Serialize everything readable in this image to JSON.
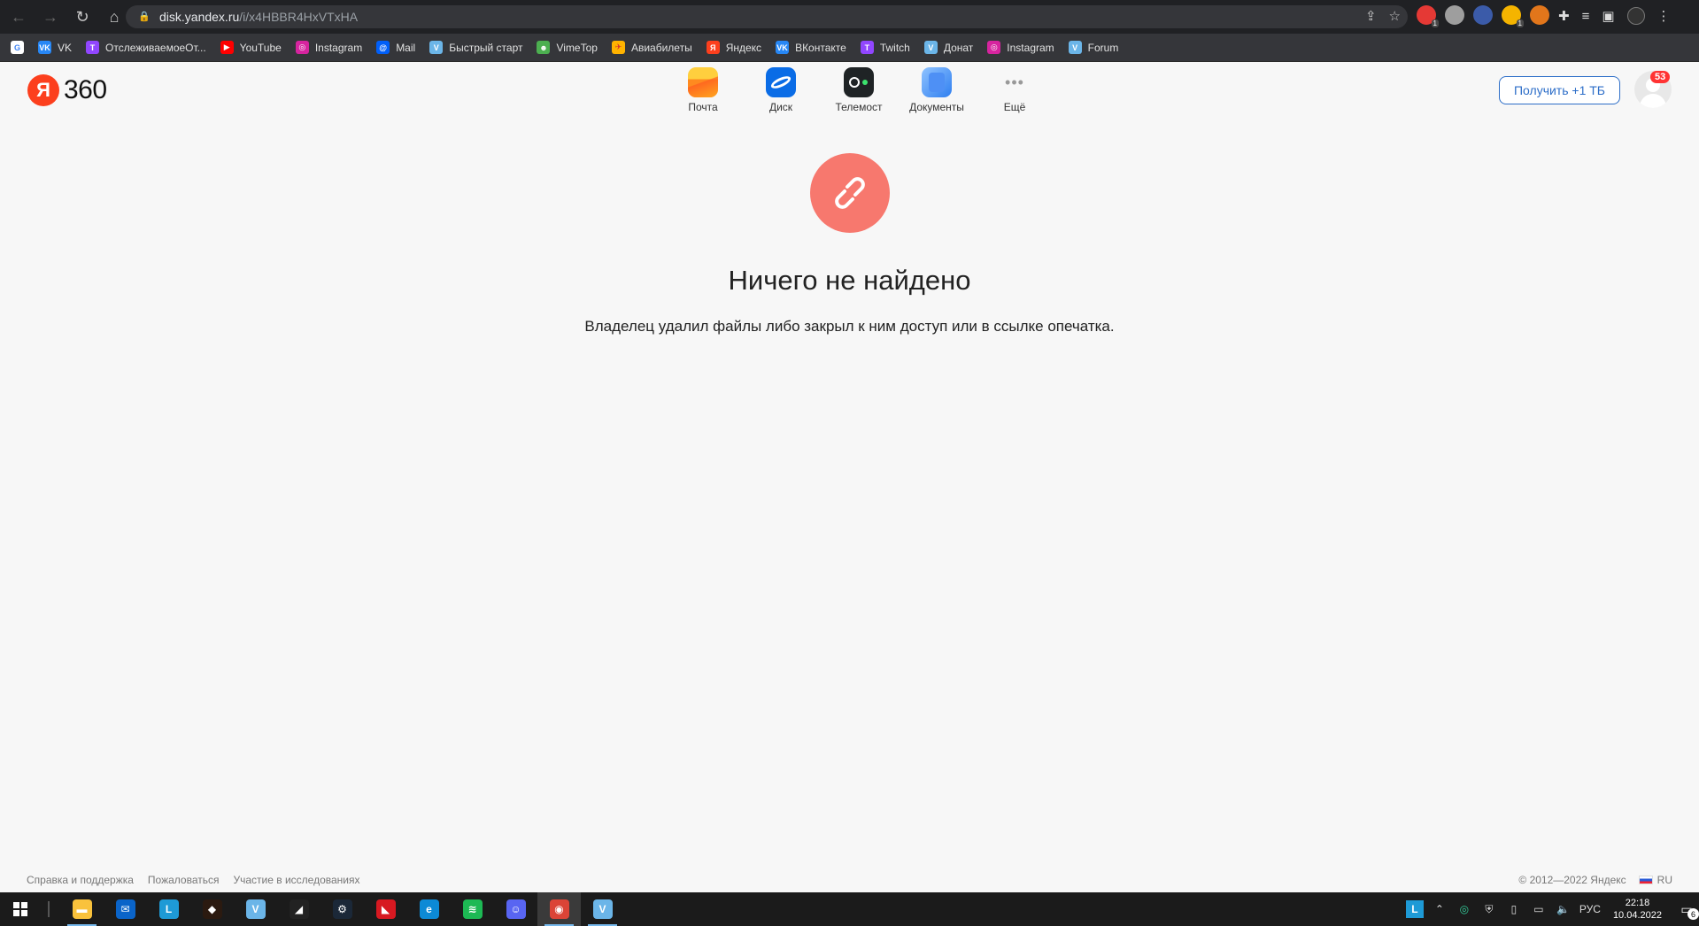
{
  "browser": {
    "url_host": "disk.yandex.ru",
    "url_path": "/i/x4HBBR4HxVTxHA",
    "extensions": [
      {
        "name": "adblock-icon",
        "color": "#e53935",
        "badge": "1"
      },
      {
        "name": "download-icon",
        "color": "#9e9e9e",
        "badge": ""
      },
      {
        "name": "translate-icon",
        "color": "#3b5ba9",
        "badge": ""
      },
      {
        "name": "coin-icon",
        "color": "#f5b400",
        "badge": "1"
      },
      {
        "name": "fox-icon",
        "color": "#e2761b",
        "badge": ""
      }
    ]
  },
  "bookmarks": [
    {
      "label": "",
      "icon": "G",
      "color": "#ffffff",
      "fg": "#4285f4",
      "name": "google-icon"
    },
    {
      "label": "VK",
      "icon": "VK",
      "color": "#2787f5",
      "fg": "#fff",
      "name": "vk-icon"
    },
    {
      "label": "ОтслеживаемоеОт...",
      "icon": "T",
      "color": "#9146ff",
      "fg": "#fff",
      "name": "twitch-icon"
    },
    {
      "label": "YouTube",
      "icon": "▶",
      "color": "#ff0000",
      "fg": "#fff",
      "name": "youtube-icon"
    },
    {
      "label": "Instagram",
      "icon": "◎",
      "color": "#d6249f",
      "fg": "#fff",
      "name": "instagram-icon"
    },
    {
      "label": "Mail",
      "icon": "@",
      "color": "#005ff9",
      "fg": "#fff",
      "name": "mail-icon"
    },
    {
      "label": "Быстрый старт",
      "icon": "V",
      "color": "#6bb5e8",
      "fg": "#fff",
      "name": "vimeworld-icon"
    },
    {
      "label": "VimeTop",
      "icon": "☻",
      "color": "#4caf50",
      "fg": "#fff",
      "name": "vimetop-icon"
    },
    {
      "label": "Авиабилеты",
      "icon": "✈",
      "color": "#ffb300",
      "fg": "#d32f2f",
      "name": "aviasales-icon"
    },
    {
      "label": "Яндекс",
      "icon": "Я",
      "color": "#fc3f1d",
      "fg": "#fff",
      "name": "yandex-icon"
    },
    {
      "label": "ВКонтакте",
      "icon": "VK",
      "color": "#2787f5",
      "fg": "#fff",
      "name": "vkontakte-icon"
    },
    {
      "label": "Twitch",
      "icon": "T",
      "color": "#9146ff",
      "fg": "#fff",
      "name": "twitch-icon"
    },
    {
      "label": "Донат",
      "icon": "V",
      "color": "#6bb5e8",
      "fg": "#fff",
      "name": "vimeworld-icon"
    },
    {
      "label": "Instagram",
      "icon": "◎",
      "color": "#d6249f",
      "fg": "#fff",
      "name": "instagram-icon"
    },
    {
      "label": "Forum",
      "icon": "V",
      "color": "#6bb5e8",
      "fg": "#fff",
      "name": "vimeworld-icon"
    }
  ],
  "header": {
    "logo_letter": "Я",
    "logo_text": "360",
    "services": [
      {
        "label": "Почта",
        "name": "mail-service-icon"
      },
      {
        "label": "Диск",
        "name": "disk-service-icon"
      },
      {
        "label": "Телемост",
        "name": "telemost-service-icon"
      },
      {
        "label": "Документы",
        "name": "documents-service-icon"
      },
      {
        "label": "Ещё",
        "name": "more-service-icon"
      }
    ],
    "get_tb_label": "Получить +1 ТБ",
    "notifications_count": "53"
  },
  "empty_state": {
    "title": "Ничего не найдено",
    "message": "Владелец удалил файлы либо закрыл к ним доступ или в ссылке опечатка."
  },
  "footer": {
    "links": [
      "Справка и поддержка",
      "Пожаловаться",
      "Участие в исследованиях"
    ],
    "copyright": "© 2012—2022 Яндекс",
    "language": "RU"
  },
  "taskbar": {
    "apps": [
      {
        "name": "file-explorer-icon",
        "color": "#f9c23c",
        "glyph": "▬",
        "underline": true
      },
      {
        "name": "mail-app-icon",
        "color": "#0a64c9",
        "glyph": "✉",
        "underline": false
      },
      {
        "name": "launcher-l-icon",
        "color": "#1e9ad6",
        "glyph": "L",
        "underline": false
      },
      {
        "name": "shield-app-icon",
        "color": "#2b1a10",
        "glyph": "◆",
        "underline": false
      },
      {
        "name": "vimeworld-app-icon",
        "color": "#6bb5e8",
        "glyph": "V",
        "underline": false
      },
      {
        "name": "tlauncher-icon",
        "color": "#222222",
        "glyph": "◢",
        "underline": false
      },
      {
        "name": "steam-icon",
        "color": "#1b2838",
        "glyph": "⚙",
        "underline": false
      },
      {
        "name": "amd-icon",
        "color": "#d71921",
        "glyph": "◣",
        "underline": false
      },
      {
        "name": "edge-icon",
        "color": "#0c8ad6",
        "glyph": "e",
        "underline": false
      },
      {
        "name": "spotify-icon",
        "color": "#1db954",
        "glyph": "≋",
        "underline": false
      },
      {
        "name": "discord-icon",
        "color": "#5865f2",
        "glyph": "☺",
        "underline": false
      },
      {
        "name": "chrome-icon",
        "color": "#db4437",
        "glyph": "◉",
        "underline": true,
        "active": true
      },
      {
        "name": "vimeworld-app-icon",
        "color": "#6bb5e8",
        "glyph": "V",
        "underline": true
      }
    ],
    "language": "РУС",
    "time": "22:18",
    "date": "10.04.2022",
    "notifications": "6"
  }
}
